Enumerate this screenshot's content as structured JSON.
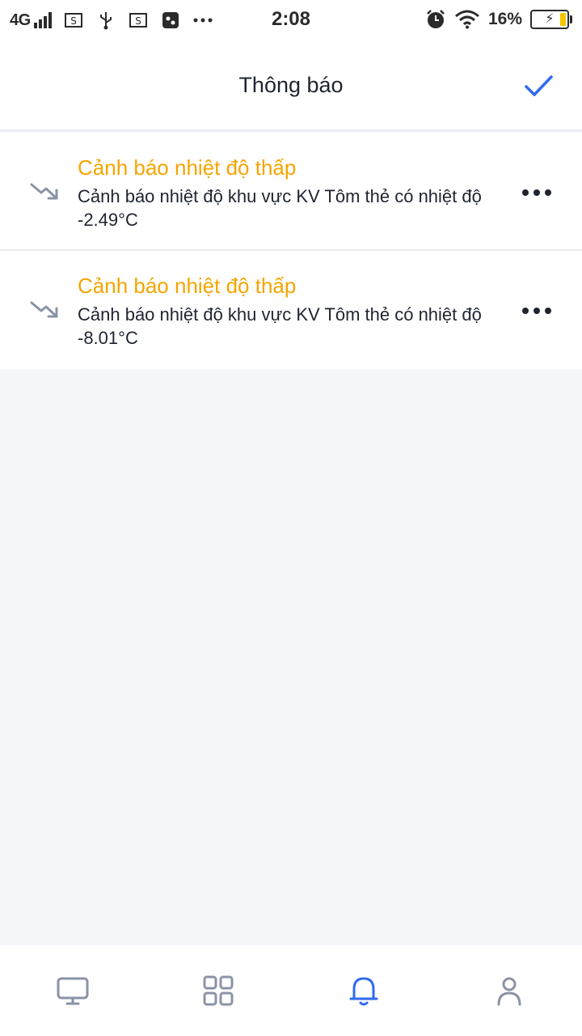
{
  "status_bar": {
    "network": "4G",
    "time": "2:08",
    "battery_percent": "16%",
    "icons": [
      "signal-icon",
      "screenshot-icon",
      "usb-icon",
      "screenshot-icon",
      "app-icon",
      "more-icon",
      "alarm-icon",
      "wifi-icon",
      "battery-icon"
    ]
  },
  "header": {
    "title": "Thông báo",
    "confirm_icon": "check-icon"
  },
  "notifications": [
    {
      "icon": "trending-down-icon",
      "title": "Cảnh báo nhiệt độ thấp",
      "body": "Cảnh báo nhiệt độ khu vực KV Tôm thẻ có nhiệt độ -2.49°C"
    },
    {
      "icon": "trending-down-icon",
      "title": "Cảnh báo nhiệt độ thấp",
      "body": "Cảnh báo nhiệt độ khu vực KV Tôm thẻ có nhiệt độ -8.01°C"
    }
  ],
  "bottom_nav": {
    "items": [
      "monitor-icon",
      "grid-icon",
      "bell-icon",
      "user-icon"
    ],
    "active": "bell-icon"
  },
  "colors": {
    "accent": "#2f6bef",
    "warning": "#f5a500",
    "icon_gray": "#8a93a6",
    "background": "#f5f7fb"
  }
}
